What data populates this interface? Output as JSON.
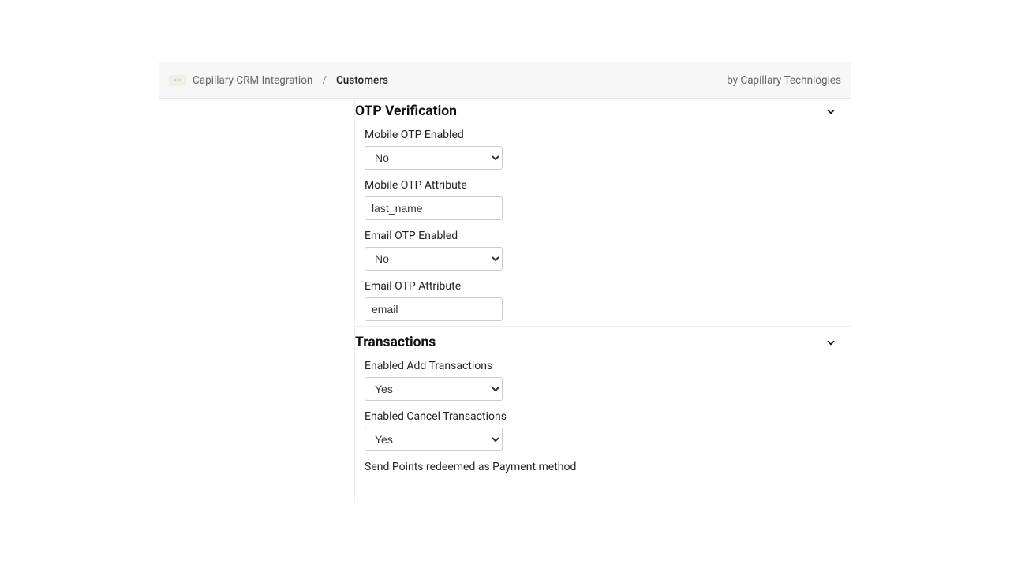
{
  "header": {
    "breadcrumb_parent": "Capillary CRM Integration",
    "breadcrumb_sep": "/",
    "breadcrumb_current": "Customers",
    "by_text": "by Capillary Technlogies"
  },
  "options": {
    "yes": "Yes",
    "no": "No"
  },
  "sections": {
    "otp": {
      "title": "OTP Verification",
      "mobile_enabled_label": "Mobile OTP Enabled",
      "mobile_enabled_value": "No",
      "mobile_attr_label": "Mobile OTP Attribute",
      "mobile_attr_value": "last_name",
      "email_enabled_label": "Email OTP Enabled",
      "email_enabled_value": "No",
      "email_attr_label": "Email OTP Attribute",
      "email_attr_value": "email"
    },
    "txn": {
      "title": "Transactions",
      "add_label": "Enabled Add Transactions",
      "add_value": "Yes",
      "cancel_label": "Enabled Cancel Transactions",
      "cancel_value": "Yes",
      "points_label": "Send Points redeemed as Payment method"
    }
  }
}
